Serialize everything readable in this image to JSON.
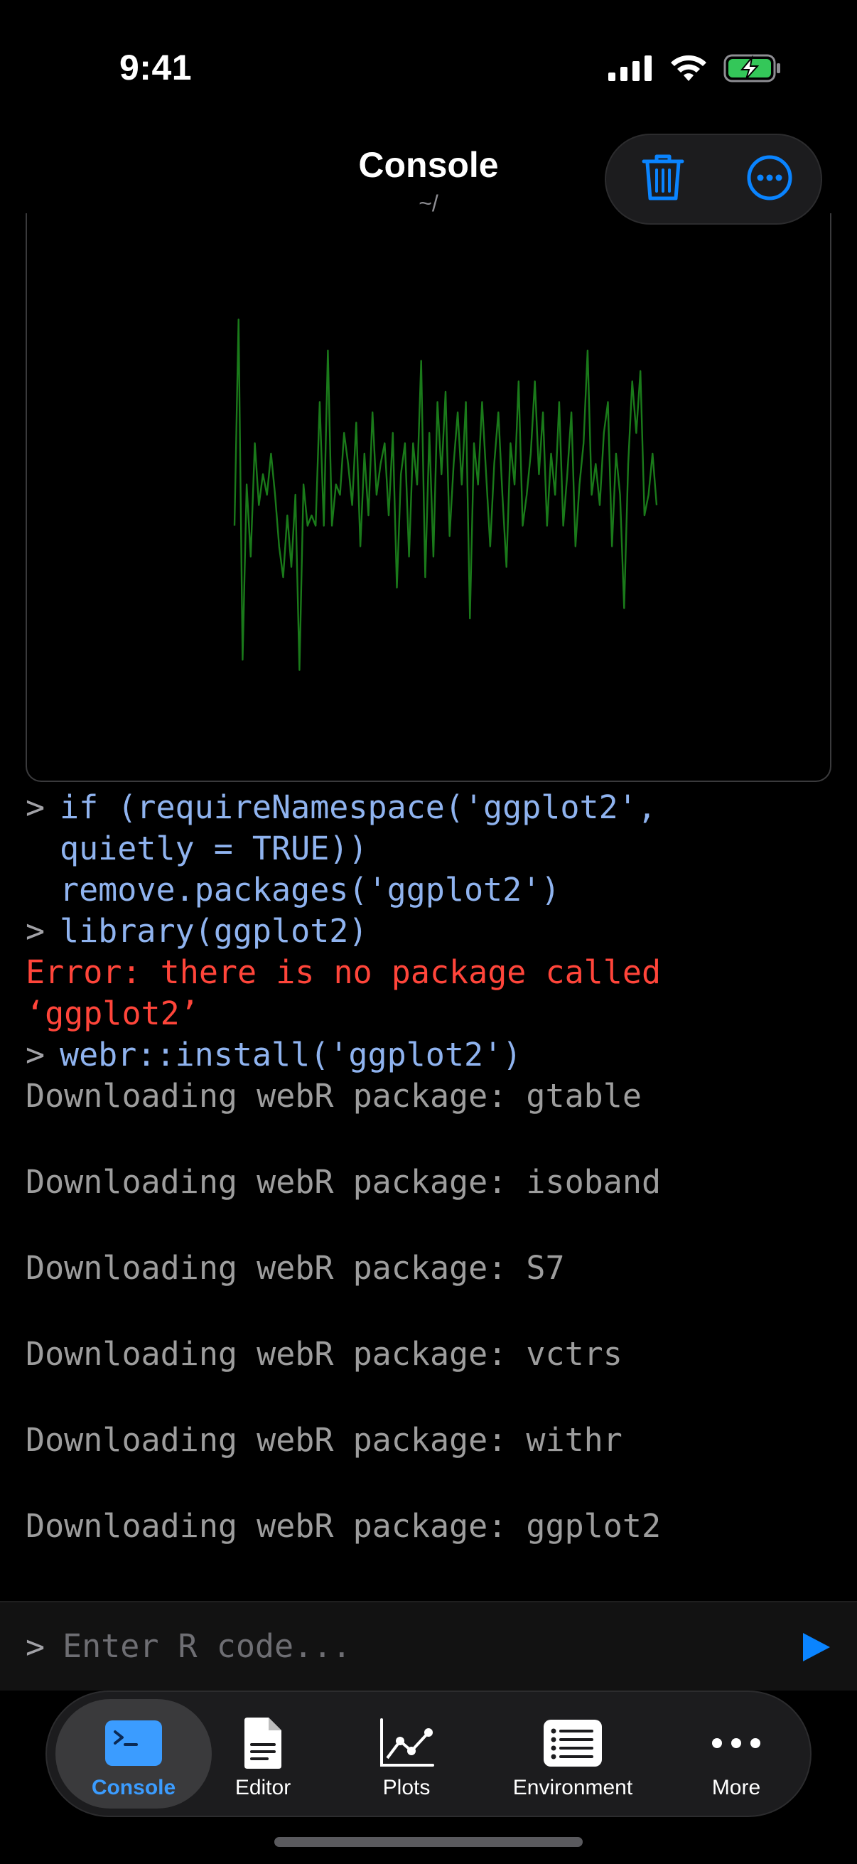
{
  "status": {
    "time": "9:41"
  },
  "nav": {
    "title": "Console",
    "subtitle": "~/"
  },
  "plot": {
    "line_color": "#1a7a1a",
    "y_values": [
      -0.3,
      1.7,
      -1.6,
      0.1,
      -0.6,
      0.5,
      -0.1,
      0.2,
      0.0,
      0.4,
      0.0,
      -0.5,
      -0.8,
      -0.2,
      -0.7,
      0.0,
      -1.7,
      0.1,
      -0.3,
      -0.2,
      -0.3,
      0.9,
      -0.3,
      1.4,
      -0.3,
      0.1,
      0.0,
      0.6,
      0.3,
      -0.1,
      0.7,
      -0.5,
      0.4,
      -0.2,
      0.8,
      0.0,
      0.3,
      0.5,
      -0.2,
      0.6,
      -0.9,
      0.2,
      0.5,
      -0.6,
      0.5,
      0.1,
      1.3,
      -0.8,
      0.6,
      -0.6,
      0.9,
      0.2,
      1.0,
      -0.4,
      0.3,
      0.8,
      0.1,
      0.9,
      -1.2,
      0.5,
      0.1,
      0.9,
      0.2,
      -0.5,
      0.3,
      0.8,
      0.0,
      -0.7,
      0.5,
      0.1,
      1.1,
      -0.3,
      0.0,
      0.4,
      1.1,
      0.2,
      0.8,
      -0.3,
      0.4,
      0.0,
      0.9,
      -0.3,
      0.2,
      0.8,
      -0.5,
      0.1,
      0.5,
      1.4,
      0.0,
      0.3,
      -0.1,
      0.6,
      0.9,
      -0.5,
      0.4,
      0.0,
      -1.1,
      0.3,
      1.1,
      0.6,
      1.2,
      -0.2,
      0.0,
      0.4,
      -0.1
    ]
  },
  "console": {
    "prompt": ">",
    "lines": [
      {
        "kind": "cmd",
        "text": "if (requireNamespace('ggplot2',\nquietly = TRUE))\nremove.packages('ggplot2')"
      },
      {
        "kind": "cmd",
        "text": "library(ggplot2)"
      },
      {
        "kind": "err",
        "text": "Error: there is no package called\n‘ggplot2’"
      },
      {
        "kind": "cmd",
        "text": "webr::install('ggplot2')"
      },
      {
        "kind": "out",
        "text": "Downloading webR package: gtable"
      },
      {
        "kind": "out",
        "text": "Downloading webR package: isoband"
      },
      {
        "kind": "out",
        "text": "Downloading webR package: S7"
      },
      {
        "kind": "out",
        "text": "Downloading webR package: vctrs"
      },
      {
        "kind": "out",
        "text": "Downloading webR package: withr"
      },
      {
        "kind": "out",
        "text": "Downloading webR package: ggplot2"
      }
    ]
  },
  "input": {
    "prompt": ">",
    "placeholder": "Enter R code..."
  },
  "tabs": [
    {
      "label": "Console",
      "icon": "terminal-icon",
      "active": true
    },
    {
      "label": "Editor",
      "icon": "document-icon",
      "active": false
    },
    {
      "label": "Plots",
      "icon": "chart-icon",
      "active": false
    },
    {
      "label": "Environment",
      "icon": "list-icon",
      "active": false
    },
    {
      "label": "More",
      "icon": "ellipsis-icon",
      "active": false
    }
  ],
  "colors": {
    "accent": "#0a84ff",
    "error": "#ff453a",
    "command": "#8fb3ef",
    "battery": "#34c759"
  }
}
